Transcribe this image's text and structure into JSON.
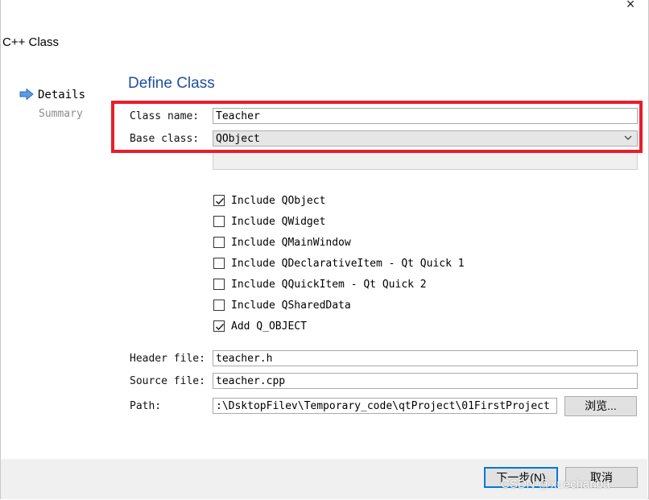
{
  "window": {
    "title": "C++ Class",
    "close_glyph": "×"
  },
  "steps": {
    "current": "Details",
    "next": "Summary",
    "current_icon": "arrow-right-icon"
  },
  "section_title": "Define Class",
  "form": {
    "class_name_label": "Class name:",
    "class_name_value": "Teacher",
    "base_class_label": "Base class:",
    "base_class_value": "QObject",
    "header_file_label": "Header file:",
    "header_file_value": "teacher.h",
    "source_file_label": "Source file:",
    "source_file_value": "teacher.cpp",
    "path_label": "Path:",
    "path_value": ":\\DsktopFilev\\Temporary_code\\qtProject\\01FirstProject",
    "browse_label": "浏览..."
  },
  "options": [
    {
      "label": "Include QObject",
      "checked": true
    },
    {
      "label": "Include QWidget",
      "checked": false
    },
    {
      "label": "Include QMainWindow",
      "checked": false
    },
    {
      "label": "Include QDeclarativeItem - Qt Quick 1",
      "checked": false
    },
    {
      "label": "Include QQuickItem - Qt Quick 2",
      "checked": false
    },
    {
      "label": "Include QSharedData",
      "checked": false
    },
    {
      "label": "Add Q_OBJECT",
      "checked": true
    }
  ],
  "buttons": {
    "next": "下一步(N)",
    "cancel": "取消"
  },
  "watermark": "CSDN @xuechanba",
  "colors": {
    "accent": "#1f4e9f",
    "highlight": "#e81e2b",
    "focus": "#0078d7"
  }
}
